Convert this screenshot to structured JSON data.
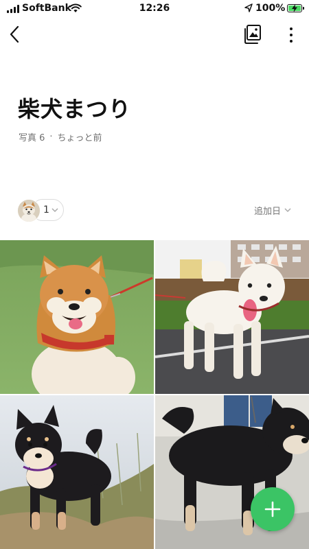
{
  "status_bar": {
    "carrier": "SoftBank",
    "time": "12:26",
    "battery_percent": "100%"
  },
  "album": {
    "title": "柴犬まつり",
    "photo_label": "写真 6",
    "separator": "·",
    "updated": "ちょっと前"
  },
  "members": {
    "count": "1"
  },
  "sort": {
    "label": "追加日"
  },
  "photos": [
    {
      "subject": "orange shiba inu sitting on grass with red harness"
    },
    {
      "subject": "white shiba inu standing on pavement"
    },
    {
      "subject": "black and tan shiba inu on grassy hill"
    },
    {
      "subject": "black and tan shiba inu walking on pavement"
    }
  ],
  "icons": {
    "back": "chevron-left-icon",
    "album": "photo-album-icon",
    "more": "vertical-dots-icon",
    "add": "plus-icon",
    "sort_caret": "chevron-down-icon"
  },
  "colors": {
    "fab": "#3bc465",
    "battery": "#4cd964",
    "meta_text": "#6f6f6f"
  }
}
